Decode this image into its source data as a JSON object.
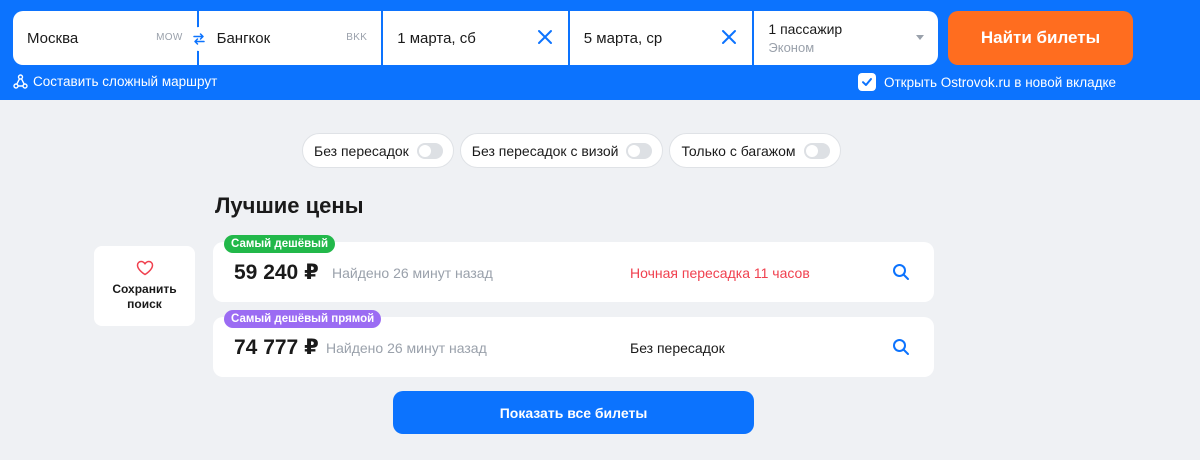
{
  "search": {
    "origin": {
      "city": "Москва",
      "code": "MOW"
    },
    "destination": {
      "city": "Бангкок",
      "code": "BKK"
    },
    "depart_date": "1 марта, сб",
    "return_date": "5 марта, ср",
    "passengers": "1 пассажир",
    "cabin_class": "Эконом",
    "find_button": "Найти билеты",
    "complex_route": "Составить сложный маршрут",
    "open_new_tab": "Открыть Ostrovok.ru в новой вкладке",
    "open_new_tab_checked": true
  },
  "filters": [
    {
      "label": "Без пересадок",
      "on": false
    },
    {
      "label": "Без пересадок с визой",
      "on": false
    },
    {
      "label": "Только с багажом",
      "on": false
    }
  ],
  "section_title": "Лучшие цены",
  "save_search": {
    "label_line1": "Сохранить",
    "label_line2": "поиск"
  },
  "results": [
    {
      "badge": "Самый дешёвый",
      "price": "59 240 ₽",
      "found": "Найдено 26 минут назад",
      "transfer": "Ночная пересадка 11 часов"
    },
    {
      "badge": "Самый дешёвый прямой",
      "price": "74 777 ₽",
      "found": "Найдено 26 минут назад",
      "transfer": "Без пересадок"
    }
  ],
  "show_all_button": "Показать все билеты",
  "colors": {
    "header_blue": "#0c73fe",
    "orange": "#ff6d1f",
    "green_badge": "#22b84a",
    "purple_badge": "#9b6cf3",
    "warning_red": "#f0414f",
    "background": "#eff1f4"
  },
  "icons": [
    "swap-icon",
    "close-icon",
    "chevron-down-icon",
    "route-icon",
    "check-icon",
    "heart-icon",
    "search-icon"
  ]
}
